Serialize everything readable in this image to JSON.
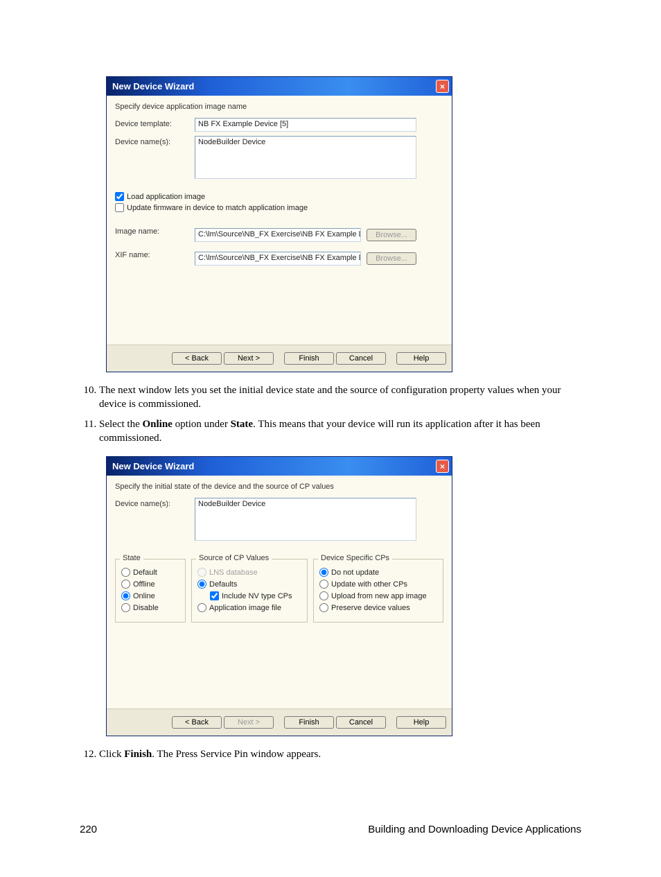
{
  "window1": {
    "title": "New Device Wizard",
    "close_glyph": "×",
    "instruction": "Specify device application image name",
    "labels": {
      "device_template": "Device template:",
      "device_names": "Device name(s):",
      "image_name": "Image name:",
      "xif_name": "XIF name:"
    },
    "values": {
      "device_template": "NB FX Example Device [5]",
      "device_names": "NodeBuilder Device",
      "image_path": "C:\\lm\\Source\\NB_FX Exercise\\NB FX Example Device\\Re",
      "xif_path": "C:\\lm\\Source\\NB_FX Exercise\\NB FX Example Device\\Re"
    },
    "checkboxes": {
      "load_app_image": "Load application image",
      "update_firmware": "Update firmware in device to match application image"
    },
    "buttons": {
      "browse": "Browse...",
      "back": "< Back",
      "next": "Next >",
      "finish": "Finish",
      "cancel": "Cancel",
      "help": "Help"
    }
  },
  "doc": {
    "item10": "The next window lets you set the initial device state and the source of configuration property values when your device is commissioned.",
    "item11_pre": "Select the ",
    "item11_bold1": "Online",
    "item11_mid": " option under ",
    "item11_bold2": "State",
    "item11_post": ".  This means that your device will run its application after it has been commissioned.",
    "item12_pre": "Click ",
    "item12_bold": "Finish",
    "item12_post": ".  The Press Service Pin window appears."
  },
  "window2": {
    "title": "New Device Wizard",
    "close_glyph": "×",
    "instruction": "Specify the initial state of the device and the source of CP values",
    "labels": {
      "device_names": "Device name(s):"
    },
    "values": {
      "device_names": "NodeBuilder Device"
    },
    "groups": {
      "state": {
        "legend": "State",
        "opts": {
          "default": "Default",
          "offline": "Offline",
          "online": "Online",
          "disable": "Disable"
        }
      },
      "source_cp": {
        "legend": "Source of CP Values",
        "opts": {
          "lns": "LNS database",
          "defaults": "Defaults",
          "include_nv": "Include NV type CPs",
          "app_image": "Application image file"
        }
      },
      "device_cp": {
        "legend": "Device Specific CPs",
        "opts": {
          "no_update": "Do not update",
          "update_other": "Update with other CPs",
          "upload_new": "Upload from new app image",
          "preserve": "Preserve device values"
        }
      }
    },
    "buttons": {
      "back": "< Back",
      "next": "Next >",
      "finish": "Finish",
      "cancel": "Cancel",
      "help": "Help"
    }
  },
  "footer": {
    "page_num": "220",
    "chapter": "Building and Downloading Device Applications"
  }
}
